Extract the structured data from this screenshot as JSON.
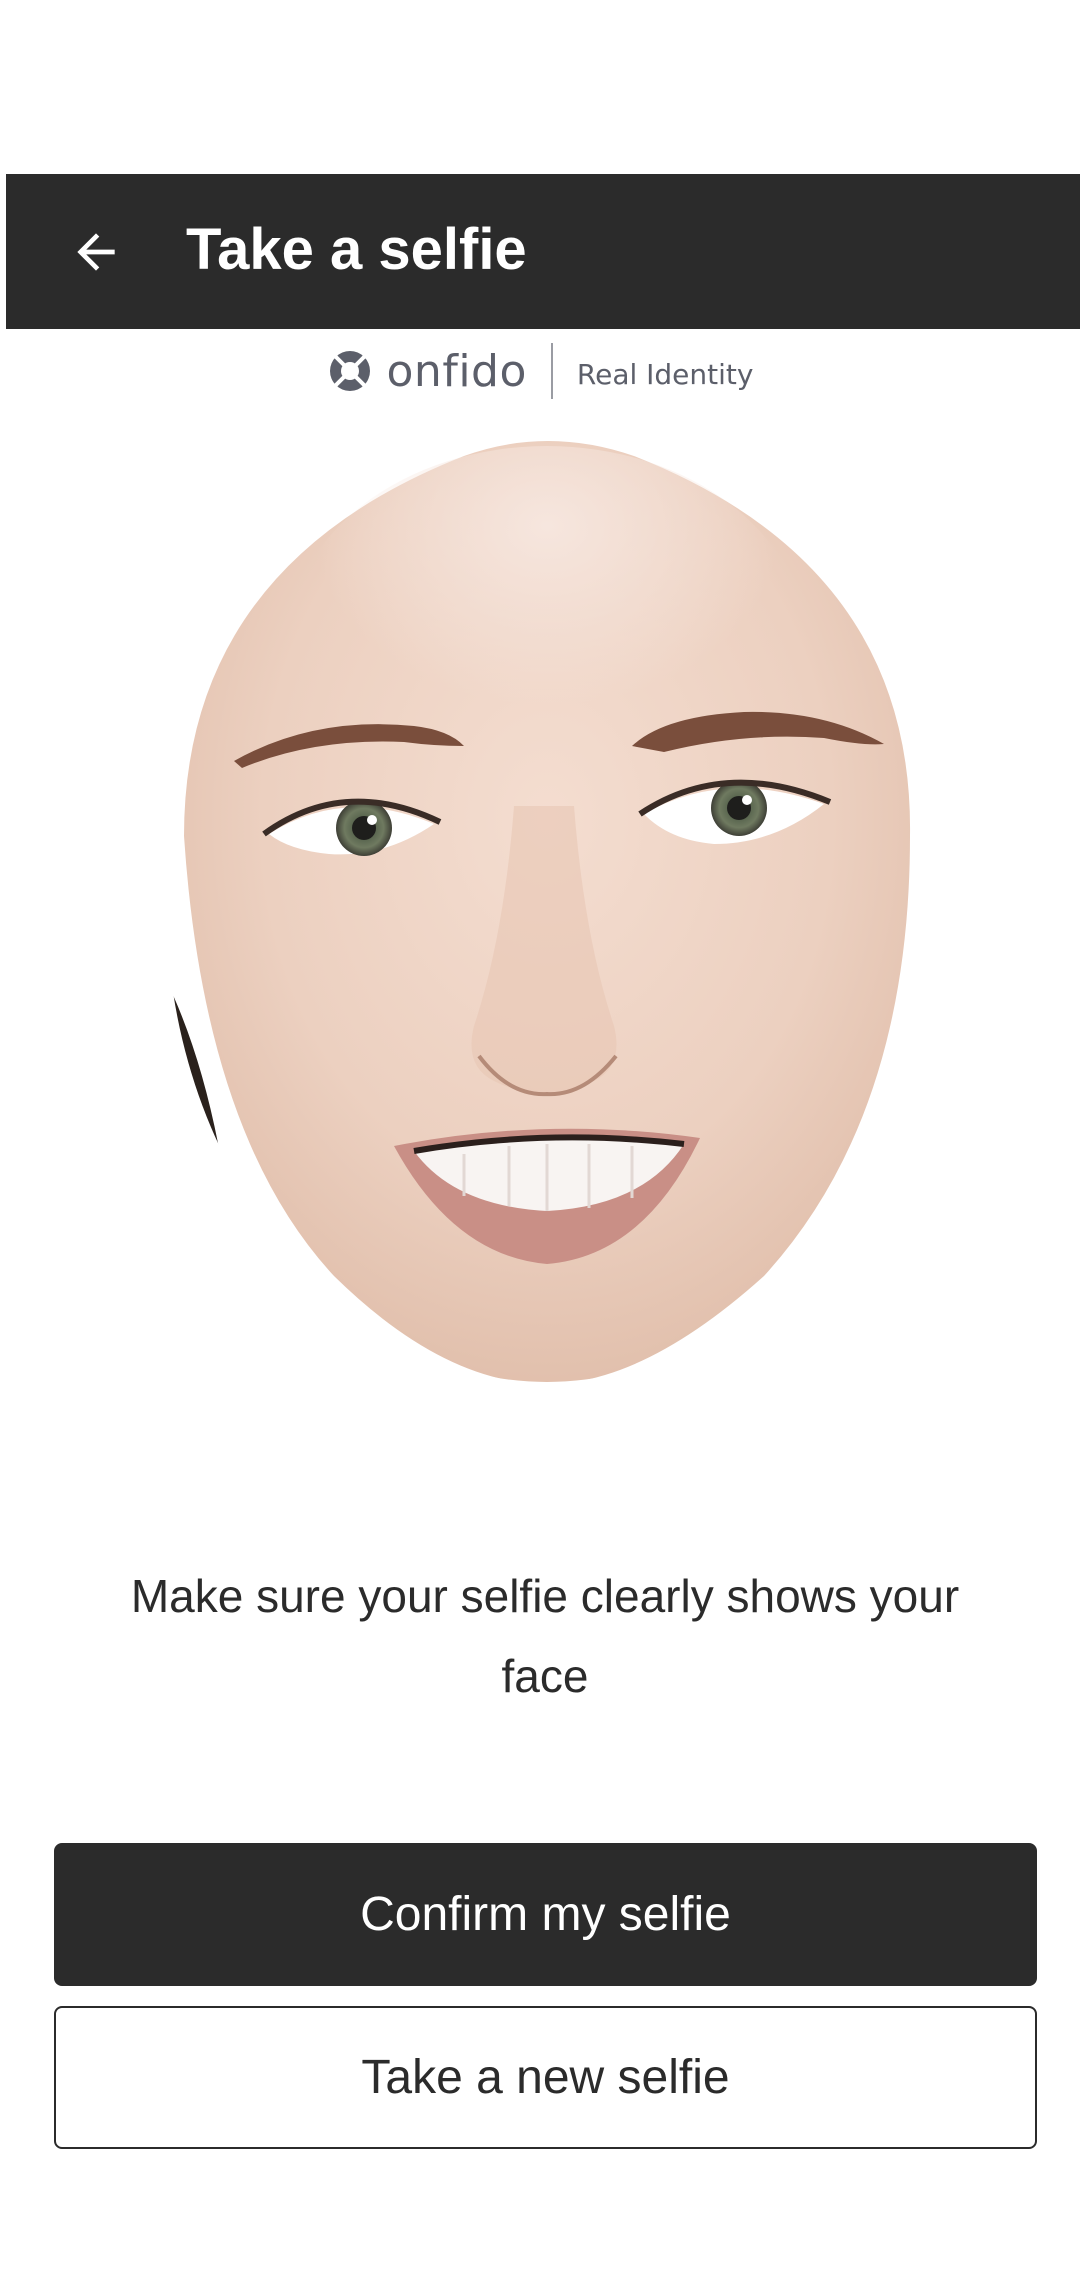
{
  "app_bar": {
    "title": "Take a selfie",
    "back_icon": "arrow-left-icon",
    "background": "#2b2b2b"
  },
  "brand": {
    "wordmark": "onfido",
    "tagline": "Real Identity",
    "logo_icon": "onfido-logo-icon"
  },
  "preview": {
    "image": "selfie-face-photo"
  },
  "instructions": {
    "text": "Make sure your selfie clearly shows your face"
  },
  "actions": {
    "confirm_label": "Confirm my selfie",
    "retake_label": "Take a new selfie"
  }
}
